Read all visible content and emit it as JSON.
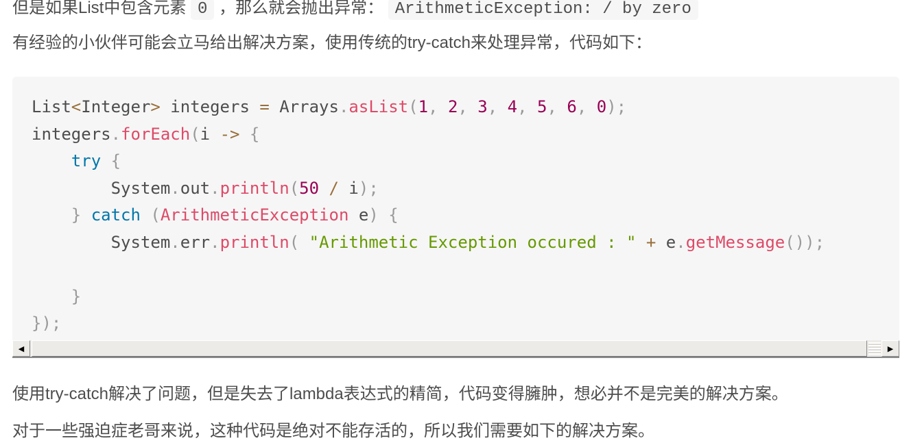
{
  "intro": {
    "line1_prefix": "但是如果List中包含元素",
    "line1_code1": "0",
    "line1_middle": "，那么就会抛出异常：",
    "line1_code2": "ArithmeticException: / by zero",
    "line2": "有经验的小伙伴可能会立马给出解决方案，使用传统的try-catch来处理异常，代码如下："
  },
  "code": {
    "language": "java",
    "lines": [
      "List<Integer> integers = Arrays.asList(1, 2, 3, 4, 5, 6, 0);",
      "integers.forEach(i -> {",
      "    try {",
      "        System.out.println(50 / i);",
      "    } catch (ArithmeticException e) {",
      "        System.err.println( \"Arithmetic Exception occured : \" + e.getMessage());",
      "",
      "    }",
      "});"
    ]
  },
  "scrollbar": {
    "left_arrow": "◀",
    "right_arrow": "▶"
  },
  "outro": {
    "line1": "使用try-catch解决了问题，但是失去了lambda表达式的精简，代码变得臃肿，想必并不是完美的解决方案。",
    "line2": "对于一些强迫症老哥来说，这种代码是绝对不能存活的，所以我们需要如下的解决方案。"
  },
  "colors": {
    "keyword": "#0077aa",
    "function": "#dd4a68",
    "number": "#990055",
    "string": "#669900",
    "operator": "#9a6e3a",
    "punctuation": "#999999",
    "code_bg": "#f6f6f6"
  }
}
